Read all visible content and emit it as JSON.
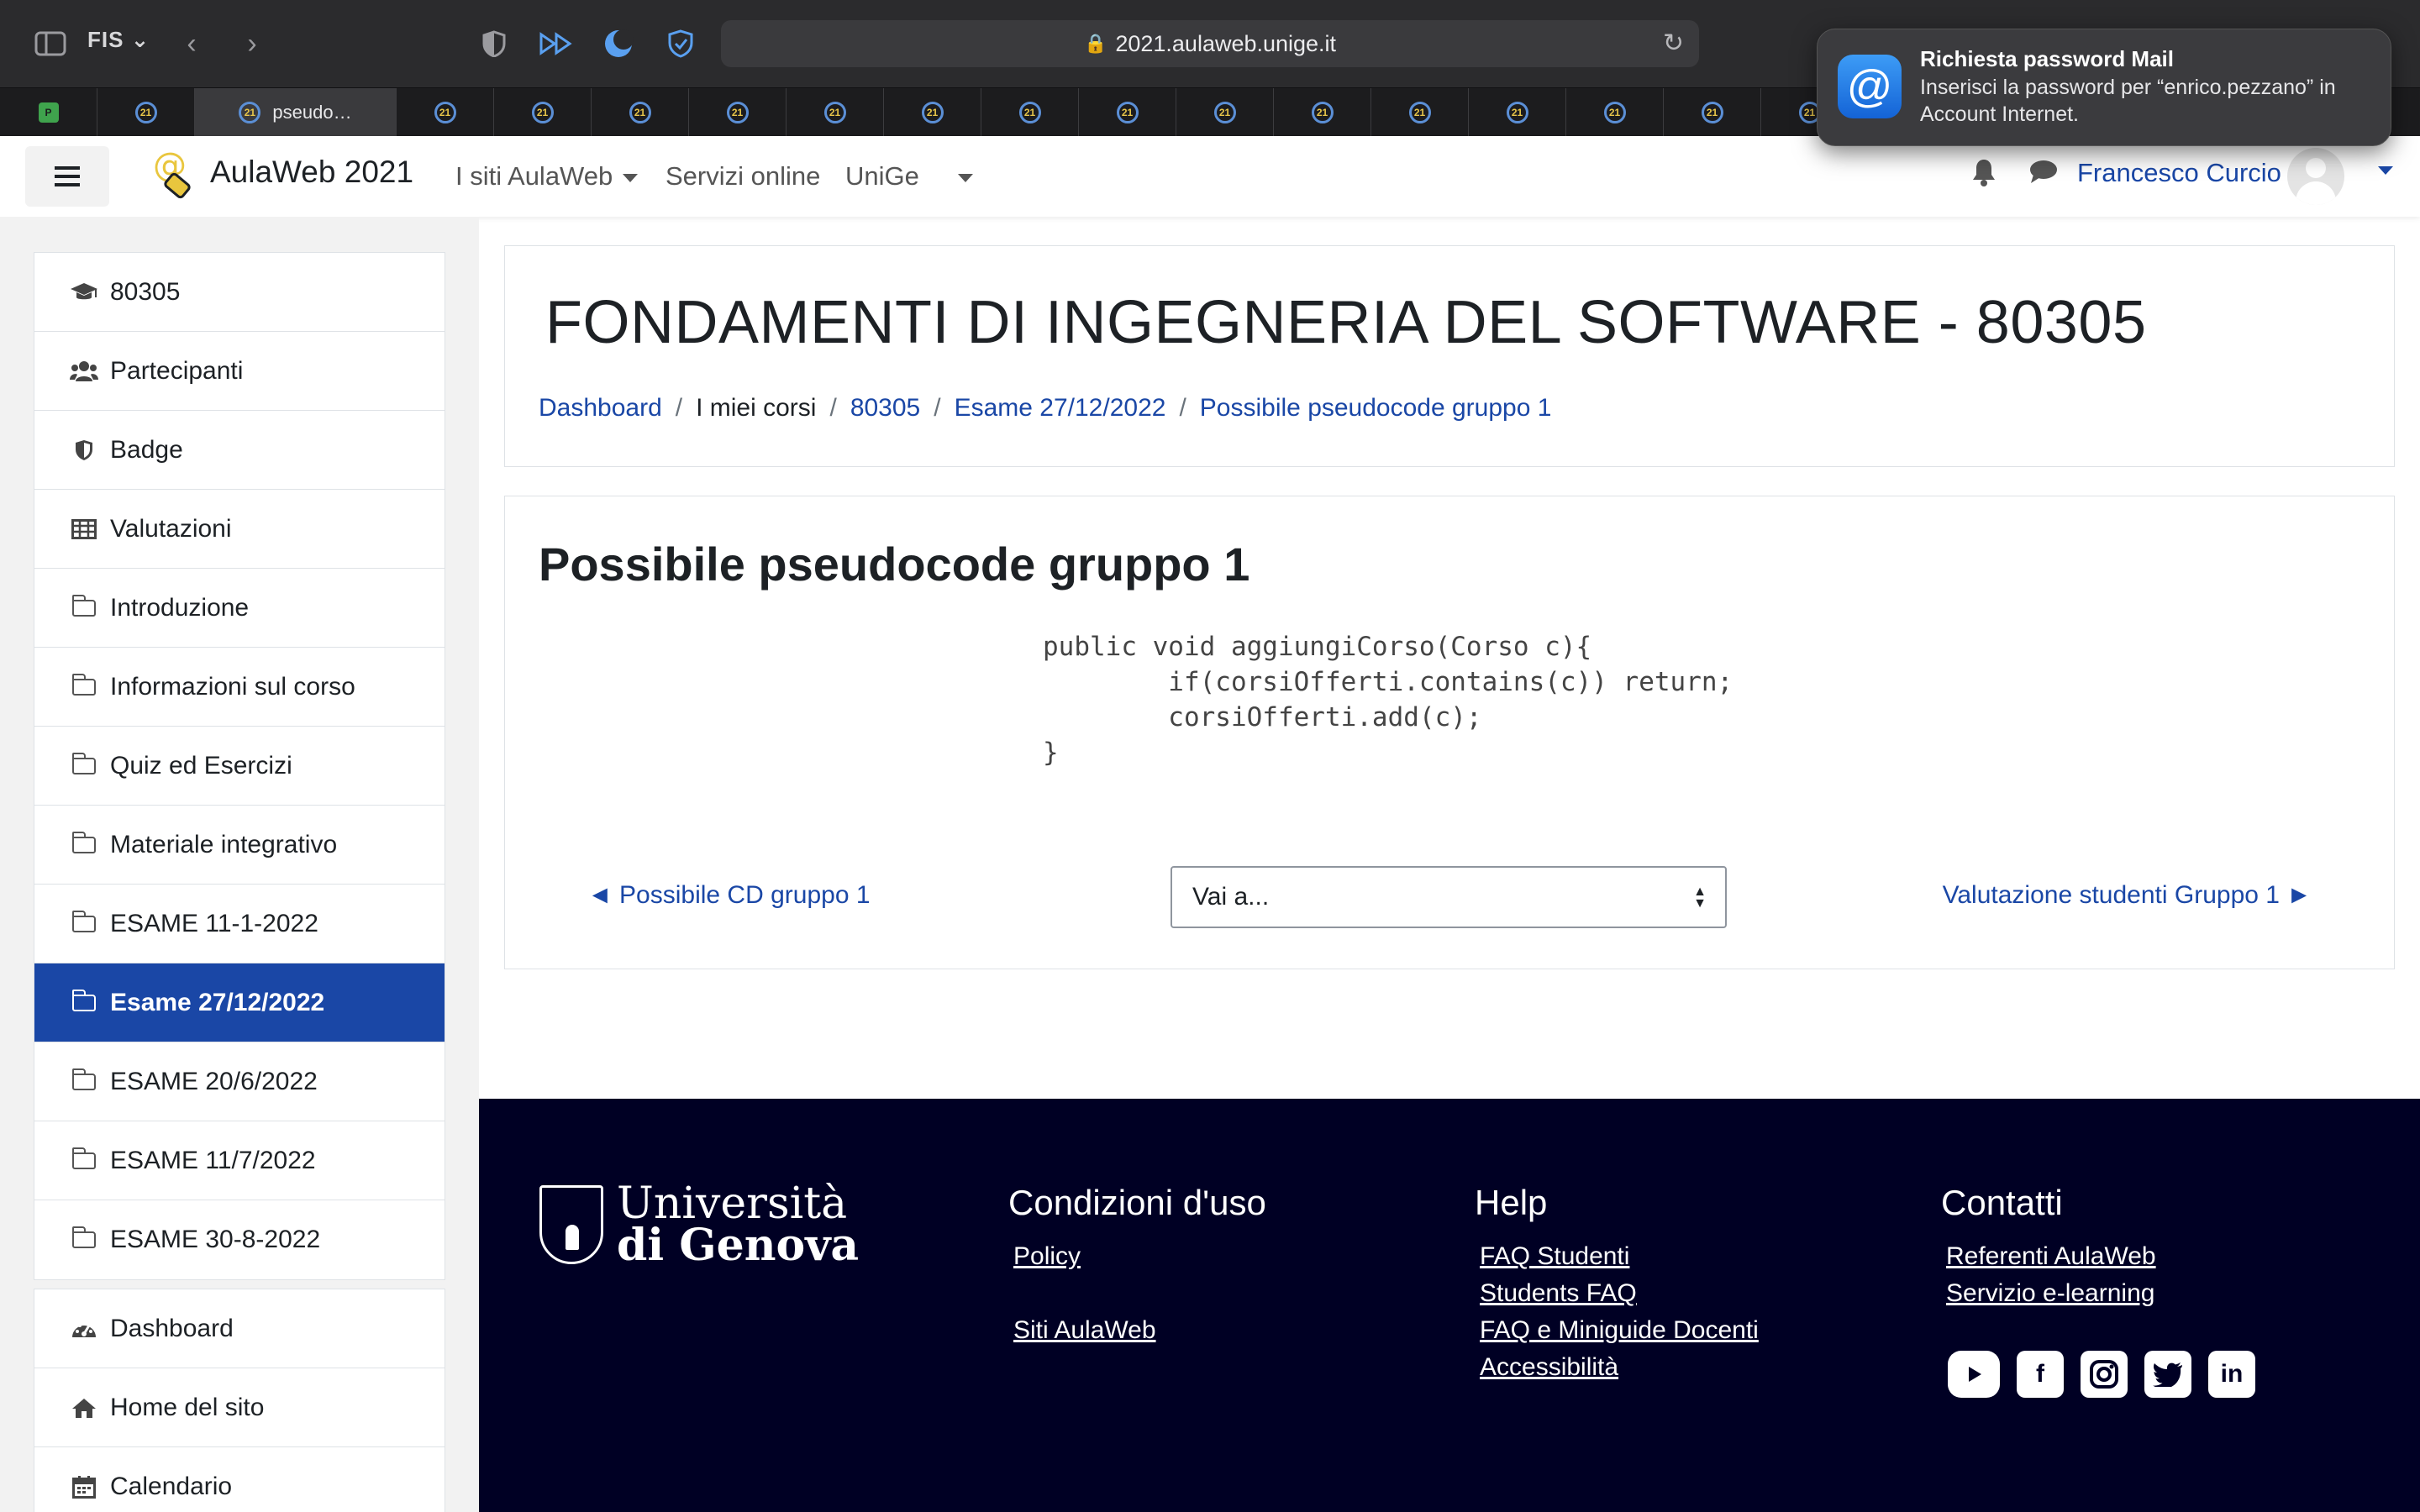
{
  "browser": {
    "profile": "FIS",
    "url": "2021.aulaweb.unige.it",
    "active_tab_title": "pseudo…"
  },
  "notification": {
    "title": "Richiesta password Mail",
    "body": "Inserisci la password per “enrico.pezzano” in Account Internet."
  },
  "navbar": {
    "brand": "AulaWeb 2021",
    "links": [
      "I siti AulaWeb",
      "Servizi online",
      "UniGe"
    ],
    "user_name": "Francesco Curcio"
  },
  "sidebar": {
    "course_items": [
      {
        "label": "80305",
        "icon": "graduation-cap-icon"
      },
      {
        "label": "Partecipanti",
        "icon": "users-icon"
      },
      {
        "label": "Badge",
        "icon": "shield-icon"
      },
      {
        "label": "Valutazioni",
        "icon": "table-icon"
      },
      {
        "label": "Introduzione",
        "icon": "folder-icon"
      },
      {
        "label": "Informazioni sul corso",
        "icon": "folder-icon"
      },
      {
        "label": "Quiz ed Esercizi",
        "icon": "folder-icon"
      },
      {
        "label": "Materiale integrativo",
        "icon": "folder-icon"
      },
      {
        "label": "ESAME 11-1-2022",
        "icon": "folder-icon"
      },
      {
        "label": "Esame 27/12/2022",
        "icon": "folder-icon",
        "active": true
      },
      {
        "label": "ESAME 20/6/2022",
        "icon": "folder-icon"
      },
      {
        "label": "ESAME 11/7/2022",
        "icon": "folder-icon"
      },
      {
        "label": "ESAME 30-8-2022",
        "icon": "folder-icon"
      }
    ],
    "site_items": [
      {
        "label": "Dashboard",
        "icon": "dashboard-icon"
      },
      {
        "label": "Home del sito",
        "icon": "home-icon"
      },
      {
        "label": "Calendario",
        "icon": "calendar-icon"
      }
    ]
  },
  "header": {
    "course_title": "FONDAMENTI DI INGEGNERIA DEL SOFTWARE - 80305",
    "breadcrumb": [
      "Dashboard",
      "I miei corsi",
      "80305",
      "Esame 27/12/2022",
      "Possibile pseudocode gruppo 1"
    ]
  },
  "content": {
    "page_title": "Possibile pseudocode gruppo 1",
    "code": "public void aggiungiCorso(Corso c){\n        if(corsiOfferti.contains(c)) return;\n        corsiOfferti.add(c);\n}",
    "prev_link": "◄ Possibile CD gruppo 1",
    "next_link": "Valutazione studenti Gruppo 1 ►",
    "jump_select": "Vai a..."
  },
  "footer": {
    "logo_line1": "Università",
    "logo_line2": "di Genova",
    "columns": [
      {
        "heading": "Condizioni d'uso",
        "links": [
          "Policy",
          "",
          "Siti AulaWeb"
        ]
      },
      {
        "heading": "Help",
        "links": [
          "FAQ Studenti",
          "Students FAQ",
          "FAQ e Miniguide Docenti",
          "Accessibilità"
        ]
      },
      {
        "heading": "Contatti",
        "links": [
          "Referenti AulaWeb",
          "Servizio e-learning"
        ]
      }
    ],
    "social": [
      "youtube-icon",
      "facebook-icon",
      "instagram-icon",
      "twitter-icon",
      "linkedin-icon"
    ]
  },
  "colors": {
    "accent": "#1a47a6",
    "footer_bg": "#000024",
    "drawer_bg": "#f2f2f2"
  }
}
